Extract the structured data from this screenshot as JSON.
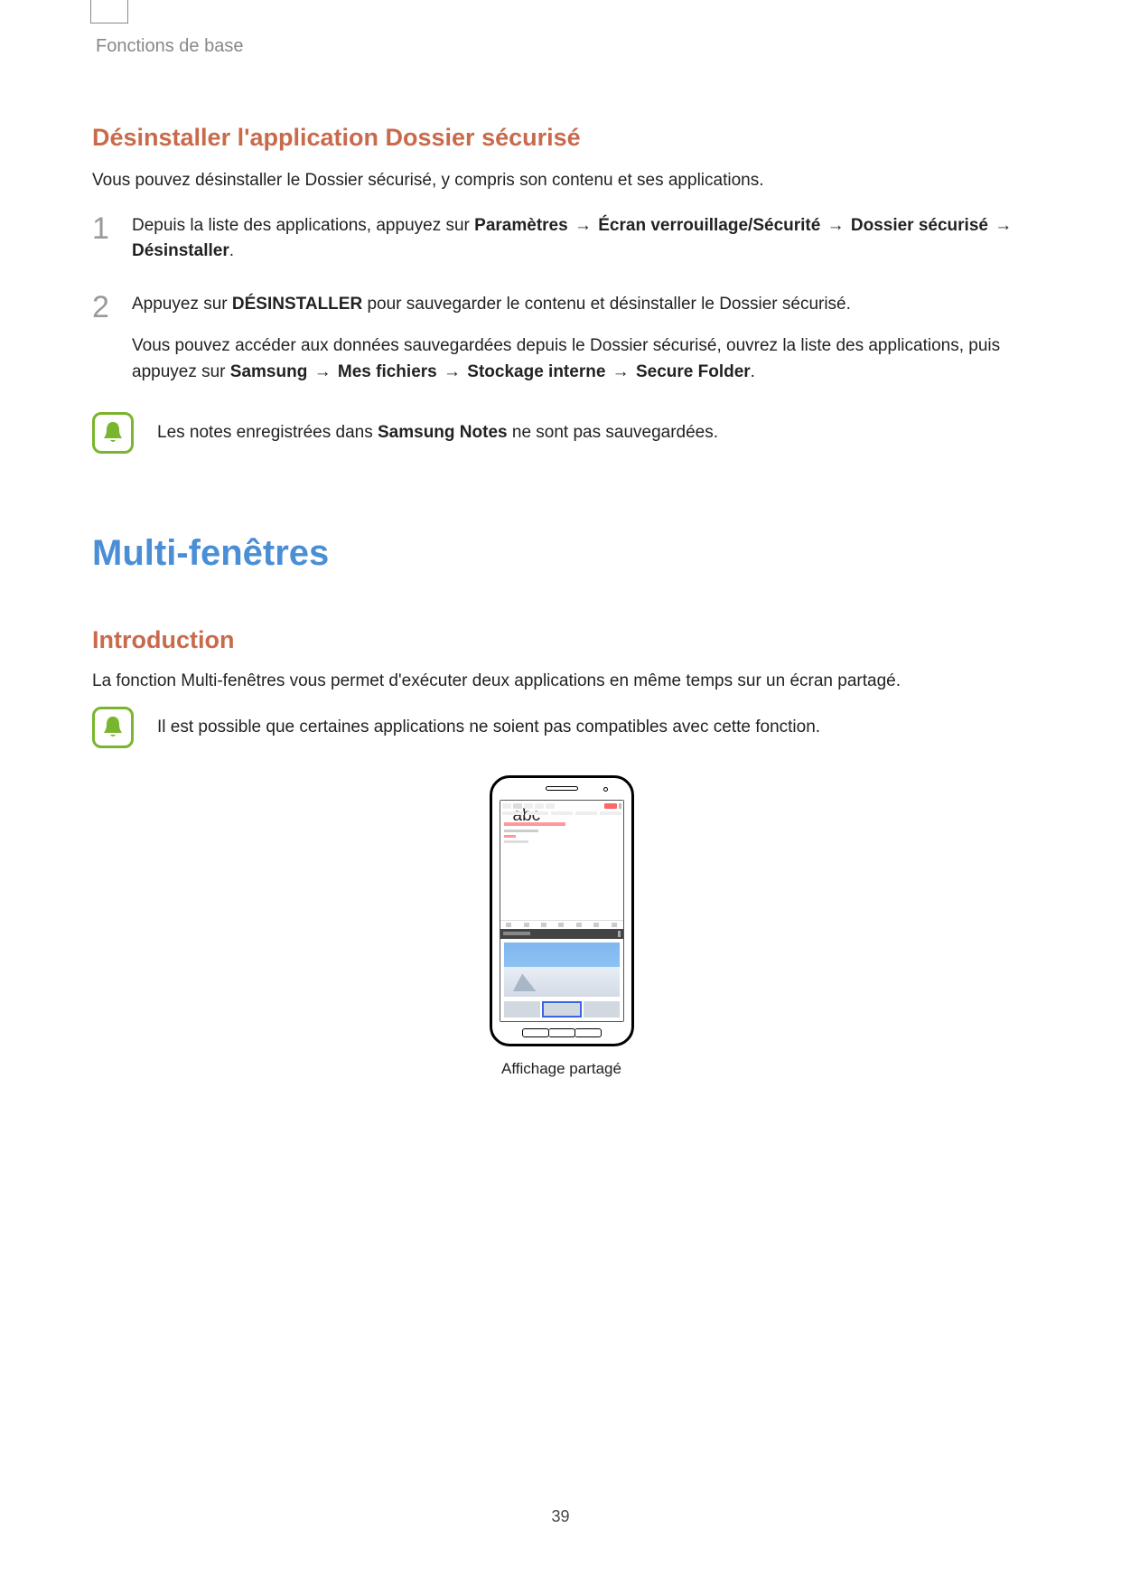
{
  "runningHeader": "Fonctions de base",
  "section1": {
    "heading": "Désinstaller l'application Dossier sécurisé",
    "intro": "Vous pouvez désinstaller le Dossier sécurisé, y compris son contenu et ses applications.",
    "step1": {
      "pre": "Depuis la liste des applications, appuyez sur ",
      "b1": "Paramètres",
      "a1": " → ",
      "b2": "Écran verrouillage/Sécurité",
      "a2": " → ",
      "b3": "Dossier sécurisé",
      "a3": " → ",
      "b4": "Désinstaller",
      "post": "."
    },
    "step2": {
      "pre": "Appuyez sur ",
      "b1": "DÉSINSTALLER",
      "post": " pour sauvegarder le contenu et désinstaller le Dossier sécurisé.",
      "para2_pre": "Vous pouvez accéder aux données sauvegardées depuis le Dossier sécurisé, ouvrez la liste des applications, puis appuyez sur ",
      "p2_b1": "Samsung",
      "p2_a1": " → ",
      "p2_b2": "Mes fichiers",
      "p2_a2": " → ",
      "p2_b3": "Stockage interne",
      "p2_a3": " → ",
      "p2_b4": "Secure Folder",
      "p2_post": "."
    },
    "note_pre": "Les notes enregistrées dans ",
    "note_bold": "Samsung Notes",
    "note_post": " ne sont pas sauvegardées."
  },
  "section2": {
    "chapterHeading": "Multi-fenêtres",
    "subHeading": "Introduction",
    "intro": "La fonction Multi-fenêtres vous permet d'exécuter deux applications en même temps sur un écran partagé.",
    "note": "Il est possible que certaines applications ne soient pas compatibles avec cette fonction.",
    "figureCaption": "Affichage partagé"
  },
  "pageNumber": "39"
}
